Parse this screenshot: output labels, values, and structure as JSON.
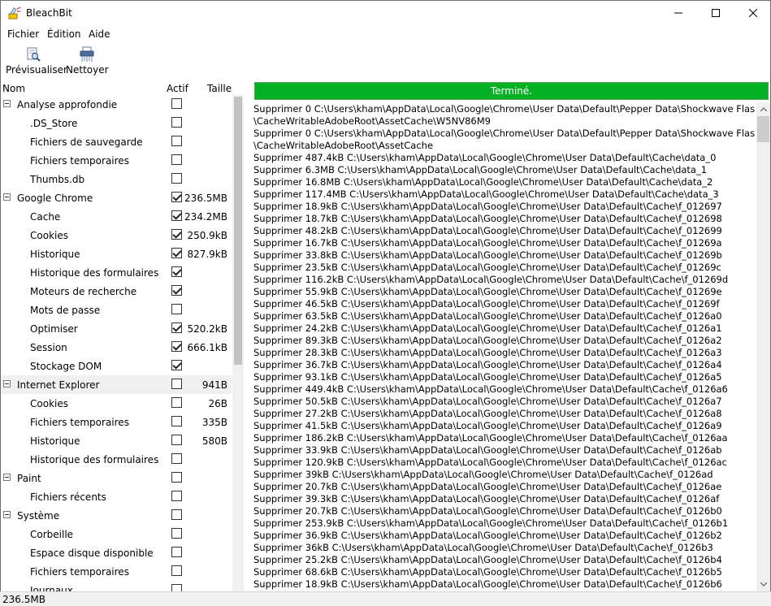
{
  "window": {
    "title": "BleachBit"
  },
  "menu": [
    "Fichier",
    "Édition",
    "Aide"
  ],
  "toolbar": {
    "preview_label": "Prévisualiser",
    "clean_label": "Nettoyer"
  },
  "tree_header": {
    "name": "Nom",
    "active": "Actif",
    "size": "Taille"
  },
  "tree": [
    {
      "label": "Analyse approfondie",
      "level": 0,
      "checked": false,
      "size": ""
    },
    {
      "label": ".DS_Store",
      "level": 1,
      "checked": false,
      "size": ""
    },
    {
      "label": "Fichiers de sauvegarde",
      "level": 1,
      "checked": false,
      "size": ""
    },
    {
      "label": "Fichiers temporaires",
      "level": 1,
      "checked": false,
      "size": ""
    },
    {
      "label": "Thumbs.db",
      "level": 1,
      "checked": false,
      "size": ""
    },
    {
      "label": "Google Chrome",
      "level": 0,
      "checked": true,
      "size": "236.5MB"
    },
    {
      "label": "Cache",
      "level": 1,
      "checked": true,
      "size": "234.2MB"
    },
    {
      "label": "Cookies",
      "level": 1,
      "checked": true,
      "size": "250.9kB"
    },
    {
      "label": "Historique",
      "level": 1,
      "checked": true,
      "size": "827.9kB"
    },
    {
      "label": "Historique des formulaires",
      "level": 1,
      "checked": true,
      "size": ""
    },
    {
      "label": "Moteurs de recherche",
      "level": 1,
      "checked": true,
      "size": ""
    },
    {
      "label": "Mots de passe",
      "level": 1,
      "checked": false,
      "size": ""
    },
    {
      "label": "Optimiser",
      "level": 1,
      "checked": true,
      "size": "520.2kB"
    },
    {
      "label": "Session",
      "level": 1,
      "checked": true,
      "size": "666.1kB"
    },
    {
      "label": "Stockage DOM",
      "level": 1,
      "checked": true,
      "size": ""
    },
    {
      "label": "Internet Explorer",
      "level": 0,
      "checked": false,
      "size": "941B",
      "highlight": true
    },
    {
      "label": "Cookies",
      "level": 1,
      "checked": false,
      "size": "26B"
    },
    {
      "label": "Fichiers temporaires",
      "level": 1,
      "checked": false,
      "size": "335B"
    },
    {
      "label": "Historique",
      "level": 1,
      "checked": false,
      "size": "580B"
    },
    {
      "label": "Historique des formulaires",
      "level": 1,
      "checked": false,
      "size": ""
    },
    {
      "label": "Paint",
      "level": 0,
      "checked": false,
      "size": ""
    },
    {
      "label": "Fichiers récents",
      "level": 1,
      "checked": false,
      "size": ""
    },
    {
      "label": "Système",
      "level": 0,
      "checked": false,
      "size": ""
    },
    {
      "label": "Corbeille",
      "level": 1,
      "checked": false,
      "size": ""
    },
    {
      "label": "Espace disque disponible",
      "level": 1,
      "checked": false,
      "size": ""
    },
    {
      "label": "Fichiers temporaires",
      "level": 1,
      "checked": false,
      "size": ""
    },
    {
      "label": "Journaux",
      "level": 1,
      "checked": false,
      "size": ""
    }
  ],
  "progress": {
    "label": "Terminé.",
    "value": 1.0
  },
  "log": [
    "Supprimer 0 C:\\Users\\kham\\AppData\\Local\\Google\\Chrome\\User Data\\Default\\Pepper Data\\Shockwave Flash",
    "\\CacheWritableAdobeRoot\\AssetCache\\W5NV86M9",
    "Supprimer 0 C:\\Users\\kham\\AppData\\Local\\Google\\Chrome\\User Data\\Default\\Pepper Data\\Shockwave Flash",
    "\\CacheWritableAdobeRoot\\AssetCache",
    "Supprimer 487.4kB C:\\Users\\kham\\AppData\\Local\\Google\\Chrome\\User Data\\Default\\Cache\\data_0",
    "Supprimer 6.3MB C:\\Users\\kham\\AppData\\Local\\Google\\Chrome\\User Data\\Default\\Cache\\data_1",
    "Supprimer 16.8MB C:\\Users\\kham\\AppData\\Local\\Google\\Chrome\\User Data\\Default\\Cache\\data_2",
    "Supprimer 117.4MB C:\\Users\\kham\\AppData\\Local\\Google\\Chrome\\User Data\\Default\\Cache\\data_3",
    "Supprimer 18.9kB C:\\Users\\kham\\AppData\\Local\\Google\\Chrome\\User Data\\Default\\Cache\\f_012697",
    "Supprimer 18.7kB C:\\Users\\kham\\AppData\\Local\\Google\\Chrome\\User Data\\Default\\Cache\\f_012698",
    "Supprimer 48.2kB C:\\Users\\kham\\AppData\\Local\\Google\\Chrome\\User Data\\Default\\Cache\\f_012699",
    "Supprimer 16.7kB C:\\Users\\kham\\AppData\\Local\\Google\\Chrome\\User Data\\Default\\Cache\\f_01269a",
    "Supprimer 33.8kB C:\\Users\\kham\\AppData\\Local\\Google\\Chrome\\User Data\\Default\\Cache\\f_01269b",
    "Supprimer 23.5kB C:\\Users\\kham\\AppData\\Local\\Google\\Chrome\\User Data\\Default\\Cache\\f_01269c",
    "Supprimer 116.2kB C:\\Users\\kham\\AppData\\Local\\Google\\Chrome\\User Data\\Default\\Cache\\f_01269d",
    "Supprimer 55.9kB C:\\Users\\kham\\AppData\\Local\\Google\\Chrome\\User Data\\Default\\Cache\\f_01269e",
    "Supprimer 46.5kB C:\\Users\\kham\\AppData\\Local\\Google\\Chrome\\User Data\\Default\\Cache\\f_01269f",
    "Supprimer 63.5kB C:\\Users\\kham\\AppData\\Local\\Google\\Chrome\\User Data\\Default\\Cache\\f_0126a0",
    "Supprimer 24.2kB C:\\Users\\kham\\AppData\\Local\\Google\\Chrome\\User Data\\Default\\Cache\\f_0126a1",
    "Supprimer 89.3kB C:\\Users\\kham\\AppData\\Local\\Google\\Chrome\\User Data\\Default\\Cache\\f_0126a2",
    "Supprimer 28.3kB C:\\Users\\kham\\AppData\\Local\\Google\\Chrome\\User Data\\Default\\Cache\\f_0126a3",
    "Supprimer 36.7kB C:\\Users\\kham\\AppData\\Local\\Google\\Chrome\\User Data\\Default\\Cache\\f_0126a4",
    "Supprimer 93.1kB C:\\Users\\kham\\AppData\\Local\\Google\\Chrome\\User Data\\Default\\Cache\\f_0126a5",
    "Supprimer 449.4kB C:\\Users\\kham\\AppData\\Local\\Google\\Chrome\\User Data\\Default\\Cache\\f_0126a6",
    "Supprimer 50.5kB C:\\Users\\kham\\AppData\\Local\\Google\\Chrome\\User Data\\Default\\Cache\\f_0126a7",
    "Supprimer 27.2kB C:\\Users\\kham\\AppData\\Local\\Google\\Chrome\\User Data\\Default\\Cache\\f_0126a8",
    "Supprimer 41.5kB C:\\Users\\kham\\AppData\\Local\\Google\\Chrome\\User Data\\Default\\Cache\\f_0126a9",
    "Supprimer 186.2kB C:\\Users\\kham\\AppData\\Local\\Google\\Chrome\\User Data\\Default\\Cache\\f_0126aa",
    "Supprimer 33.9kB C:\\Users\\kham\\AppData\\Local\\Google\\Chrome\\User Data\\Default\\Cache\\f_0126ab",
    "Supprimer 120.9kB C:\\Users\\kham\\AppData\\Local\\Google\\Chrome\\User Data\\Default\\Cache\\f_0126ac",
    "Supprimer 39kB C:\\Users\\kham\\AppData\\Local\\Google\\Chrome\\User Data\\Default\\Cache\\f_0126ad",
    "Supprimer 20.7kB C:\\Users\\kham\\AppData\\Local\\Google\\Chrome\\User Data\\Default\\Cache\\f_0126ae",
    "Supprimer 39.3kB C:\\Users\\kham\\AppData\\Local\\Google\\Chrome\\User Data\\Default\\Cache\\f_0126af",
    "Supprimer 20.7kB C:\\Users\\kham\\AppData\\Local\\Google\\Chrome\\User Data\\Default\\Cache\\f_0126b0",
    "Supprimer 253.9kB C:\\Users\\kham\\AppData\\Local\\Google\\Chrome\\User Data\\Default\\Cache\\f_0126b1",
    "Supprimer 36.9kB C:\\Users\\kham\\AppData\\Local\\Google\\Chrome\\User Data\\Default\\Cache\\f_0126b2",
    "Supprimer 36kB C:\\Users\\kham\\AppData\\Local\\Google\\Chrome\\User Data\\Default\\Cache\\f_0126b3",
    "Supprimer 25.2kB C:\\Users\\kham\\AppData\\Local\\Google\\Chrome\\User Data\\Default\\Cache\\f_0126b4",
    "Supprimer 68.6kB C:\\Users\\kham\\AppData\\Local\\Google\\Chrome\\User Data\\Default\\Cache\\f_0126b5",
    "Supprimer 18.9kB C:\\Users\\kham\\AppData\\Local\\Google\\Chrome\\User Data\\Default\\Cache\\f_0126b6"
  ],
  "status": {
    "text": "236.5MB"
  },
  "colors": {
    "progress": "#06b025"
  }
}
